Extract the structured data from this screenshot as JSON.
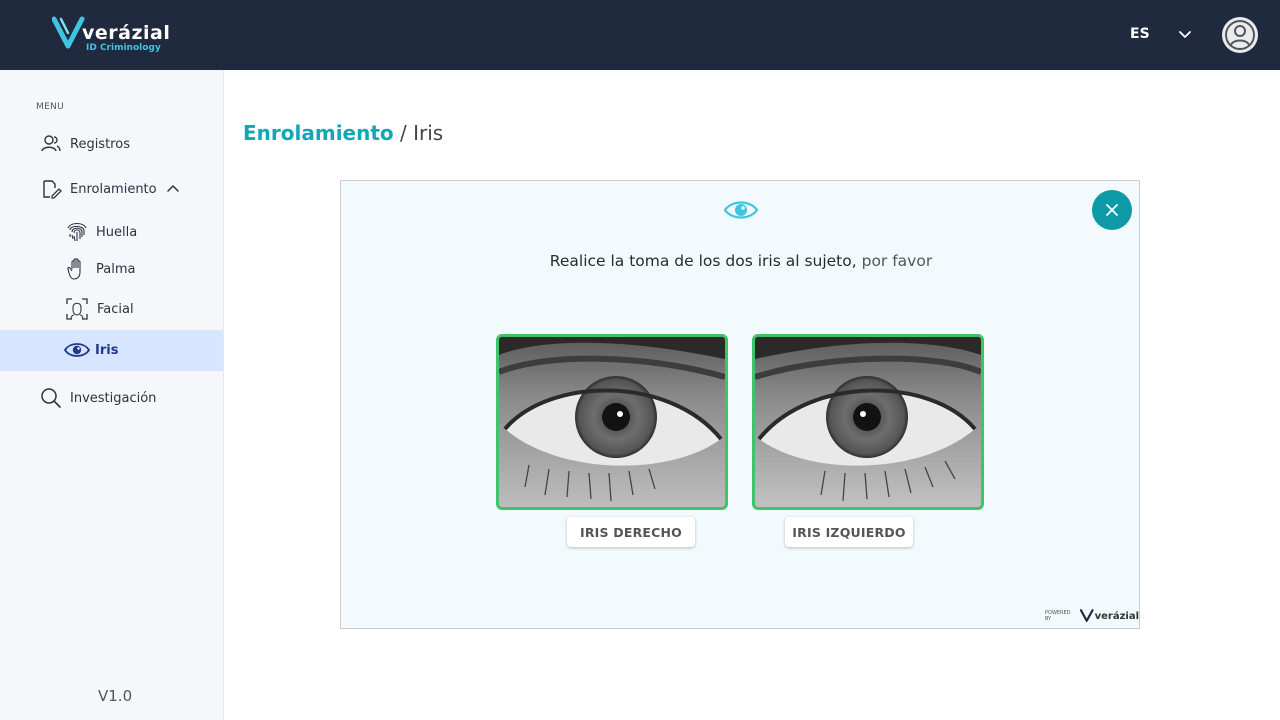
{
  "header": {
    "brand_name": "verázial",
    "brand_sub": "ID Criminology",
    "language": "ES",
    "icons": {
      "logo": "veridial-logo-icon",
      "language_dropdown": "chevron-down-icon",
      "avatar": "user-avatar-icon"
    },
    "colors": {
      "background": "#1f2a3e",
      "accent": "#3ec6e0"
    }
  },
  "sidebar": {
    "menu_label": "MENU",
    "items": [
      {
        "label": "Registros",
        "icon": "users-icon"
      },
      {
        "label": "Enrolamiento",
        "icon": "edit-document-icon",
        "expanded": true,
        "children": [
          {
            "label": "Huella",
            "icon": "fingerprint-icon"
          },
          {
            "label": "Palma",
            "icon": "palm-icon"
          },
          {
            "label": "Facial",
            "icon": "face-scan-icon"
          },
          {
            "label": "Iris",
            "icon": "eye-icon",
            "active": true
          }
        ]
      },
      {
        "label": "Investigación",
        "icon": "search-icon"
      }
    ],
    "version": "V1.0",
    "colors": {
      "background": "#f5f7fb",
      "active": "#d7e5ff"
    }
  },
  "breadcrumb": {
    "section": "Enrolamiento",
    "separator": " / ",
    "current": "Iris",
    "colors": {
      "section": "#12a7b5"
    }
  },
  "panel": {
    "instruction_main": "Realice la toma de los dos iris al sujeto,",
    "instruction_tail": " por favor",
    "eye_icon": "eye-icon",
    "close_icon": "close-icon",
    "captures": [
      {
        "label": "IRIS DERECHO",
        "status": "captured"
      },
      {
        "label": "IRIS IZQUIERDO",
        "status": "captured"
      }
    ],
    "powered_by": "POWERED BY",
    "powered_brand": "verázial",
    "colors": {
      "frame": "#3fc46a",
      "close": "#0f9aa8",
      "background": "#f3fafd"
    }
  }
}
